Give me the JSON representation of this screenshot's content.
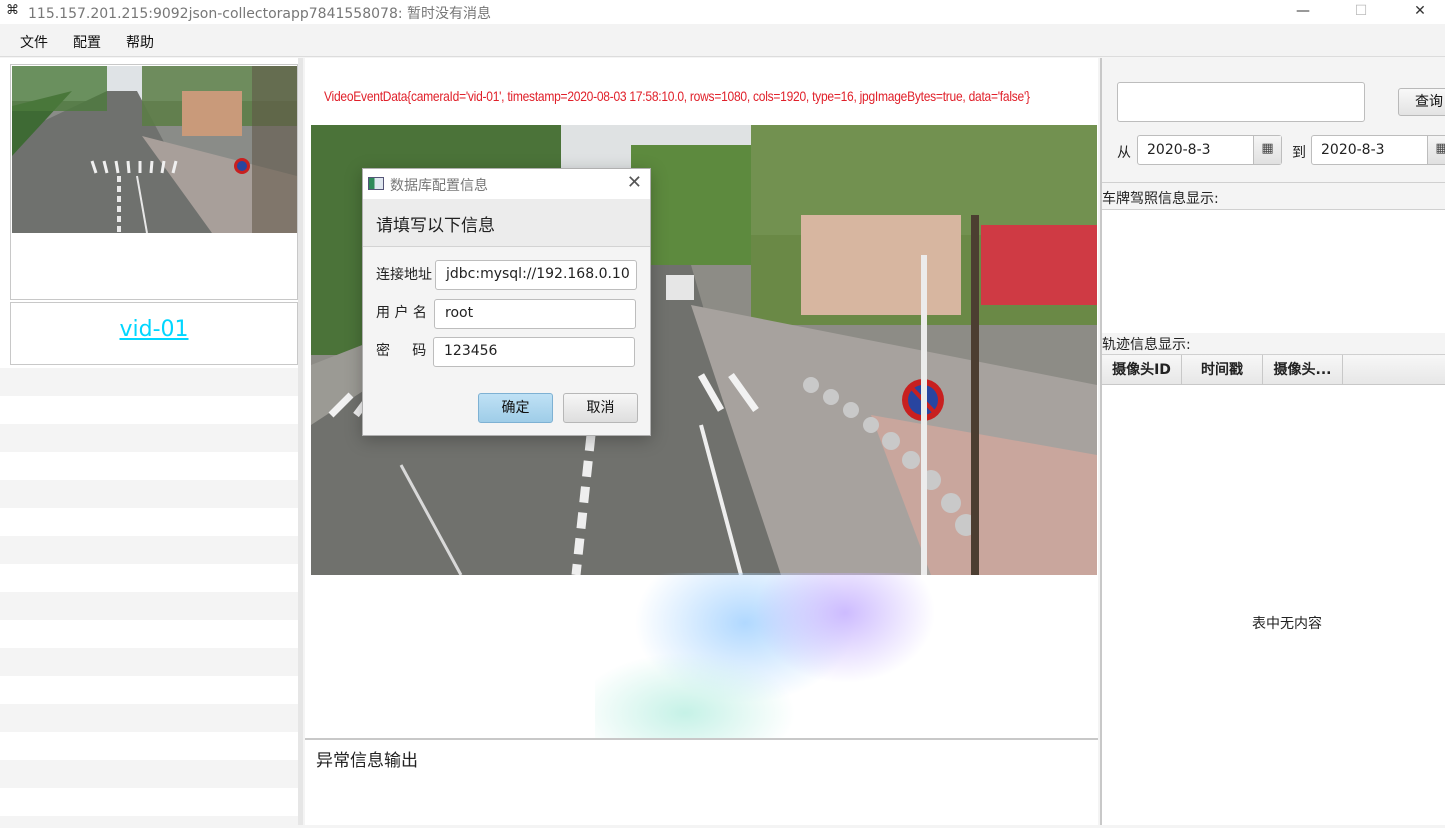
{
  "window": {
    "title": "115.157.201.215:9092json-collectorapp7841558078: 暂时没有消息",
    "minimize": "—",
    "maximize": "☐",
    "close": "✕"
  },
  "menu": [
    "文件",
    "配置",
    "帮助"
  ],
  "left": {
    "camera_label": "vid-01"
  },
  "center": {
    "event_text": "VideoEventData{cameraId='vid-01', timestamp=2020-08-03 17:58:10.0, rows=1080, cols=1920, type=16, jpgImageBytes=true, data='false'}",
    "log_title": "异常信息输出"
  },
  "right": {
    "query_button": "查询",
    "from_label": "从",
    "to_label": "到",
    "from_date": "2020-8-3",
    "to_date": "2020-8-3",
    "plate_section_title": "车牌驾照信息显示:",
    "track_section_title": "轨迹信息显示:",
    "columns": [
      "摄像头ID",
      "时间戳",
      "摄像头..."
    ],
    "empty_text": "表中无内容"
  },
  "dialog": {
    "title": "数据库配置信息",
    "header": "请填写以下信息",
    "fields": [
      {
        "label": "连接地址",
        "value": "jdbc:mysql://192.168.0.10"
      },
      {
        "label": "用 户 名",
        "value": "root"
      },
      {
        "label": "密     码",
        "value": "123456"
      }
    ],
    "ok": "确定",
    "cancel": "取消"
  },
  "colors": {
    "event_text": "#e0202a",
    "camera_link": "#00d6ff",
    "ok_button": "#a9d5ee"
  }
}
